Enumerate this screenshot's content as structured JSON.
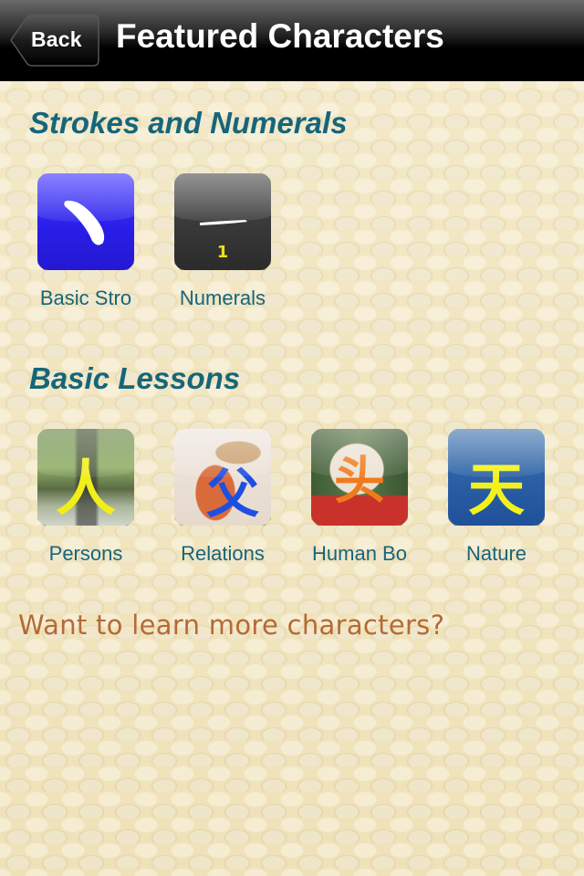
{
  "navbar": {
    "back_label": "Back",
    "title": "Featured Characters"
  },
  "sections": [
    {
      "title": "Strokes and Numerals",
      "items": [
        {
          "label": "Basic Stro",
          "icon": "stroke-icon",
          "glyph": "",
          "color": "#2a1fe8"
        },
        {
          "label": "Numerals",
          "icon": "numeral-one-icon",
          "glyph": "一",
          "sub_glyph": "1",
          "color": "#333333"
        }
      ]
    },
    {
      "title": "Basic Lessons",
      "items": [
        {
          "label": "Persons",
          "icon": "person-character-icon",
          "glyph": "人",
          "glyph_color": "#f2ee1a"
        },
        {
          "label": "Relations",
          "icon": "father-character-icon",
          "glyph": "父",
          "glyph_color": "#1f4fe0"
        },
        {
          "label": "Human Bo",
          "icon": "head-character-icon",
          "glyph": "头",
          "glyph_color": "#f07a1c"
        },
        {
          "label": "Nature",
          "icon": "sky-character-icon",
          "glyph": "天",
          "glyph_color": "#f3f11c"
        }
      ]
    }
  ],
  "cta": {
    "label": "Want to learn more characters?",
    "color": "#b56a35"
  }
}
